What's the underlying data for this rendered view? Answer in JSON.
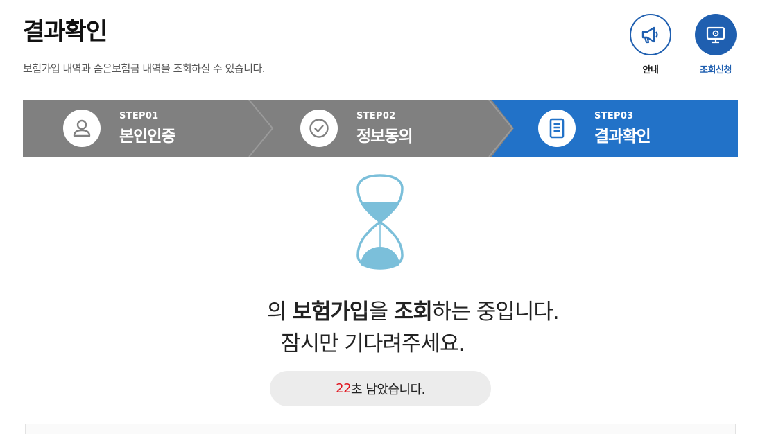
{
  "header": {
    "title": "결과확인",
    "subtitle": "보험가입 내역과 숨은보험금 내역을 조회하실 수 있습니다."
  },
  "actions": [
    {
      "label": "안내",
      "icon": "megaphone-icon"
    },
    {
      "label": "조회신청",
      "icon": "monitor-icon"
    }
  ],
  "steps": [
    {
      "num": "STEP01",
      "name": "본인인증",
      "icon": "person-icon",
      "active": false
    },
    {
      "num": "STEP02",
      "name": "정보동의",
      "icon": "check-circle-icon",
      "active": false
    },
    {
      "num": "STEP03",
      "name": "결과확인",
      "icon": "document-icon",
      "active": true
    }
  ],
  "status": {
    "line1_prefix": "의 ",
    "line1_bold1": "보험가입",
    "line1_mid": "을 ",
    "line1_bold2": "조회",
    "line1_suffix": "하는 중입니다.",
    "line2": "잠시만 기다려주세요."
  },
  "timer": {
    "seconds": "22",
    "suffix": "초 남았습니다."
  },
  "colors": {
    "accent": "#1f5fb0",
    "step_active": "#2272c8",
    "step_inactive": "#808080",
    "timer_number": "#e0141e",
    "hourglass": "#7bbfda"
  }
}
